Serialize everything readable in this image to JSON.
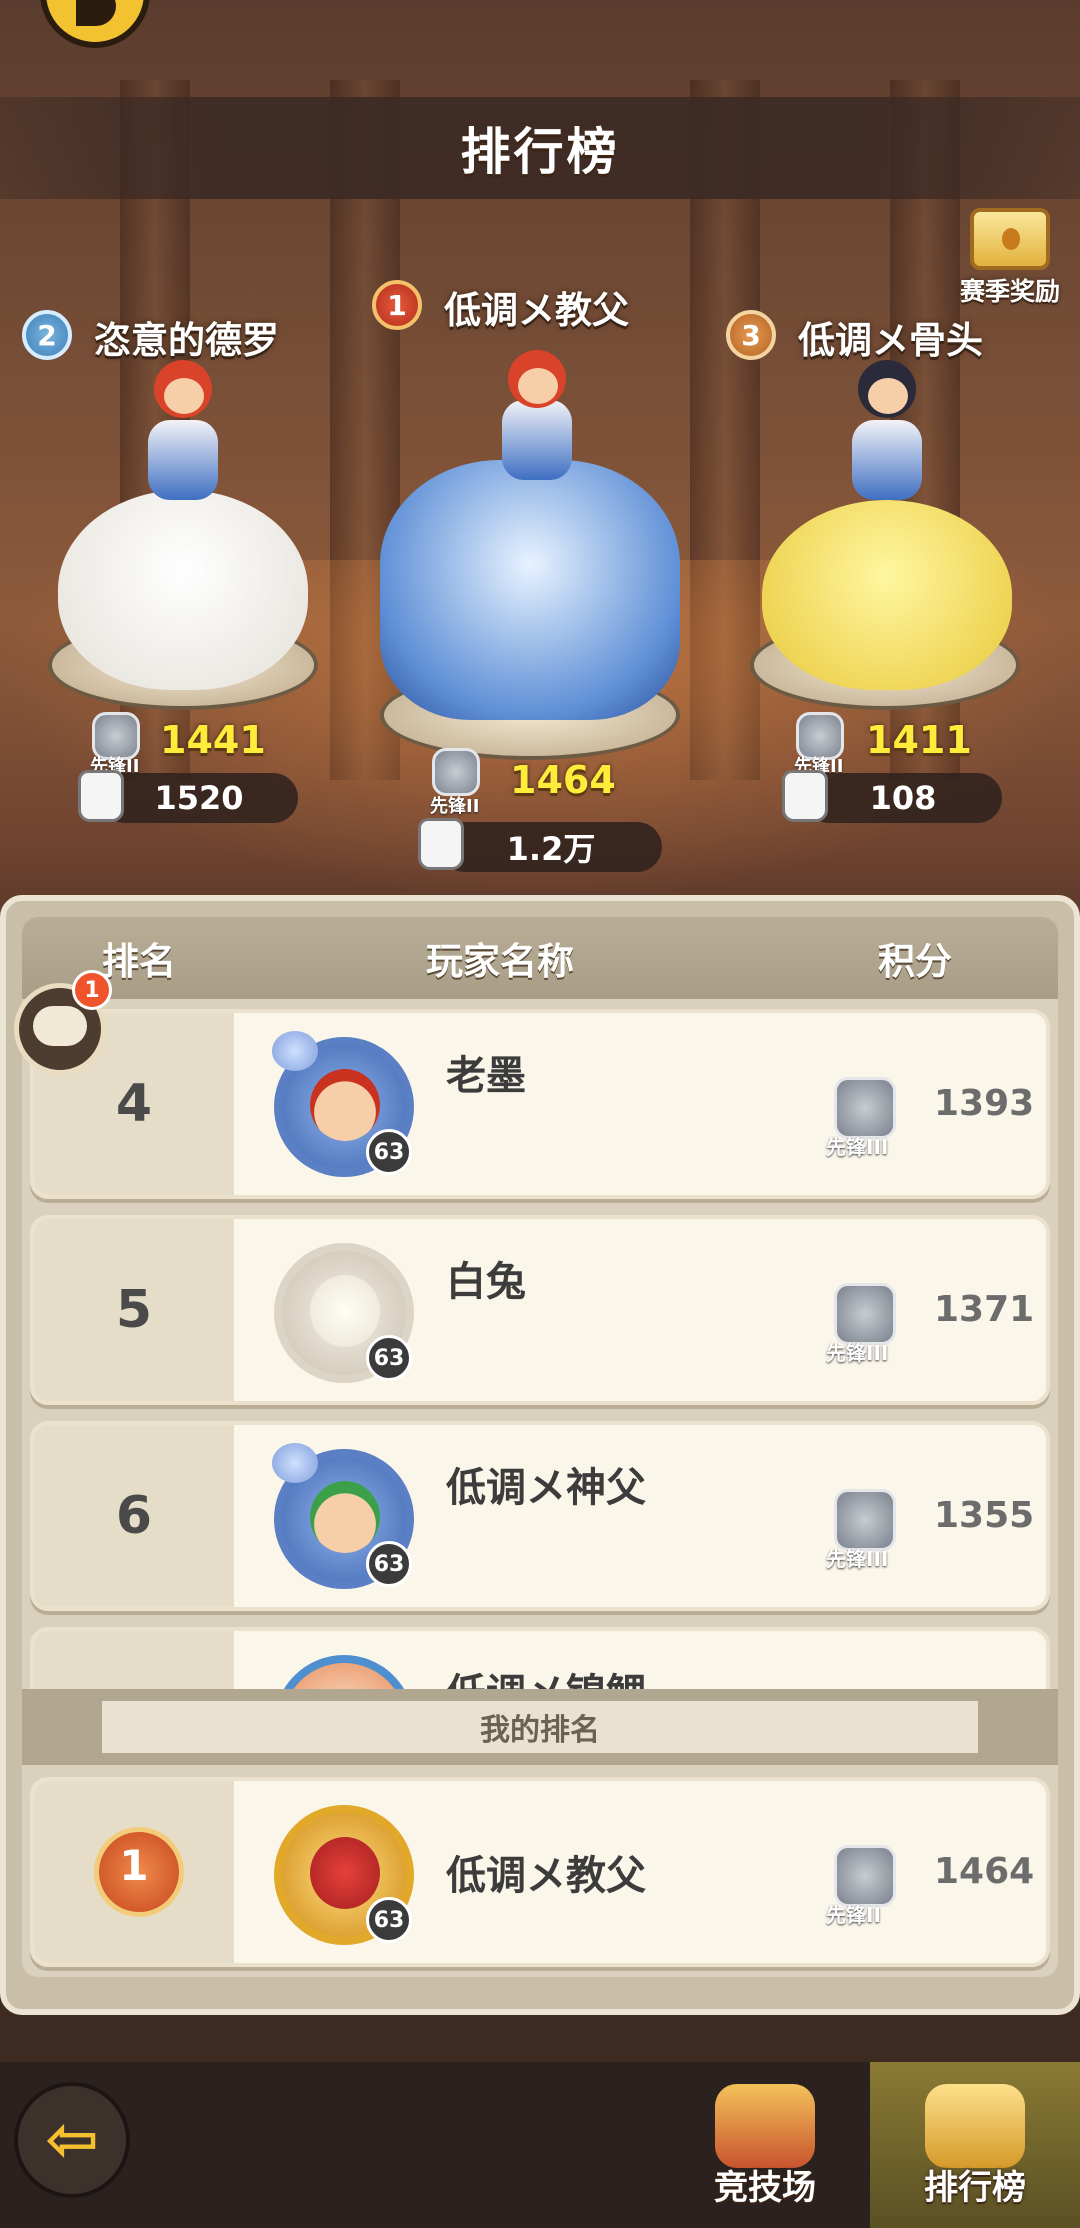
{
  "header": {
    "title": "排行榜",
    "season_reward_label": "赛季奖励"
  },
  "podium": [
    {
      "rank": "2",
      "name": "恣意的德罗",
      "tier": "先锋II",
      "score": "1441",
      "likes": "1520"
    },
    {
      "rank": "1",
      "name": "低调メ教父",
      "tier": "先锋II",
      "score": "1464",
      "likes": "1.2万"
    },
    {
      "rank": "3",
      "name": "低调メ骨头",
      "tier": "先锋II",
      "score": "1411",
      "likes": "108"
    }
  ],
  "table": {
    "columns": {
      "rank": "排名",
      "player": "玩家名称",
      "score": "积分"
    },
    "rows": [
      {
        "rank": "4",
        "name": "老墨",
        "level": "63",
        "tier": "先锋III",
        "score": "1393"
      },
      {
        "rank": "5",
        "name": "白兔",
        "level": "63",
        "tier": "先锋III",
        "score": "1371"
      },
      {
        "rank": "6",
        "name": "低调メ神父",
        "level": "63",
        "tier": "先锋III",
        "score": "1355"
      },
      {
        "rank": "",
        "name": "低调メ锦鲤",
        "level": "",
        "tier": "",
        "score": ""
      }
    ]
  },
  "chat": {
    "badge": "1"
  },
  "my_rank": {
    "label": "我的排名",
    "rank": "1",
    "name": "低调メ教父",
    "level": "63",
    "tier": "先锋II",
    "score": "1464"
  },
  "nav": {
    "arena_label": "竞技场",
    "ranking_label": "排行榜"
  },
  "colors": {
    "accent_yellow": "#ffec3a",
    "active_tab": "#8a7a34"
  }
}
